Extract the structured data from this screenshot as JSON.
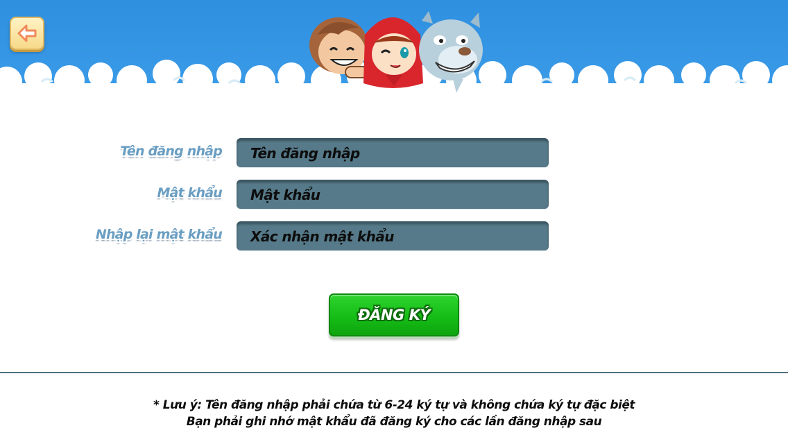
{
  "header": {
    "back_icon": "back-arrow-icon",
    "mascots": [
      "boy",
      "red-riding-hood-girl",
      "wolf"
    ],
    "sky_color": "#2f8fe0"
  },
  "form": {
    "username": {
      "label": "Tên đăng nhập",
      "placeholder": "Tên đăng nhập"
    },
    "password": {
      "label": "Mật khẩu",
      "placeholder": "Mật khẩu"
    },
    "confirm_password": {
      "label": "Nhập lại mật khẩu",
      "placeholder": "Xác nhận mật khẩu"
    },
    "input_color": "#567a89"
  },
  "register_button": {
    "label": "ĐĂNG KÝ",
    "color": "#16bd16"
  },
  "note": {
    "line1": "* Lưu ý: Tên đăng nhập phải chứa từ 6-24 ký tự và không chứa ký tự đặc biệt",
    "line2": "Bạn phải ghi nhớ mật khẩu đã đăng ký cho các lần đăng nhập sau"
  }
}
